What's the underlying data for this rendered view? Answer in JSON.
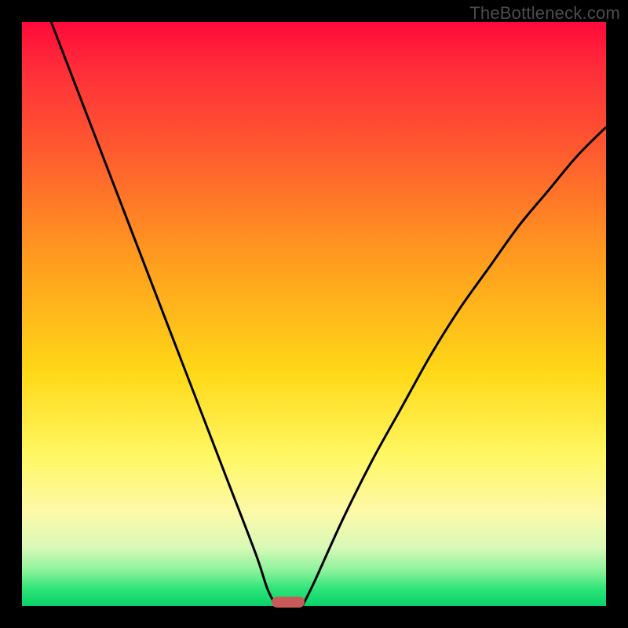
{
  "watermark": "TheBottleneck.com",
  "colors": {
    "frame": "#000000",
    "curve": "#000000",
    "marker": "#c85a5a",
    "gradient_stops": [
      {
        "pos": 0,
        "hex": "#ff0a3a"
      },
      {
        "pos": 8,
        "hex": "#ff2d3a"
      },
      {
        "pos": 22,
        "hex": "#ff5a2f"
      },
      {
        "pos": 40,
        "hex": "#ff9a1f"
      },
      {
        "pos": 60,
        "hex": "#ffd817"
      },
      {
        "pos": 74,
        "hex": "#fff761"
      },
      {
        "pos": 84,
        "hex": "#fdf9a9"
      },
      {
        "pos": 90,
        "hex": "#d8f9b7"
      },
      {
        "pos": 94,
        "hex": "#8af29a"
      },
      {
        "pos": 97,
        "hex": "#2fe57a"
      },
      {
        "pos": 100,
        "hex": "#08d267"
      }
    ]
  },
  "chart_data": {
    "type": "line",
    "title": "",
    "xlabel": "",
    "ylabel": "",
    "xlim": [
      0,
      100
    ],
    "ylim": [
      0,
      100
    ],
    "series": [
      {
        "name": "left-branch",
        "x": [
          5,
          10,
          15,
          20,
          25,
          30,
          35,
          40,
          42,
          43.5
        ],
        "y": [
          100,
          87,
          74,
          61,
          48,
          35,
          22,
          9,
          3,
          0
        ]
      },
      {
        "name": "right-branch",
        "x": [
          48,
          50,
          55,
          60,
          65,
          70,
          75,
          80,
          85,
          90,
          95,
          100
        ],
        "y": [
          0,
          4,
          15,
          25,
          34,
          43,
          51,
          58,
          65,
          71,
          77,
          82
        ]
      }
    ],
    "marker": {
      "x": 45.5,
      "y": 0,
      "shape": "rounded-bar"
    }
  }
}
